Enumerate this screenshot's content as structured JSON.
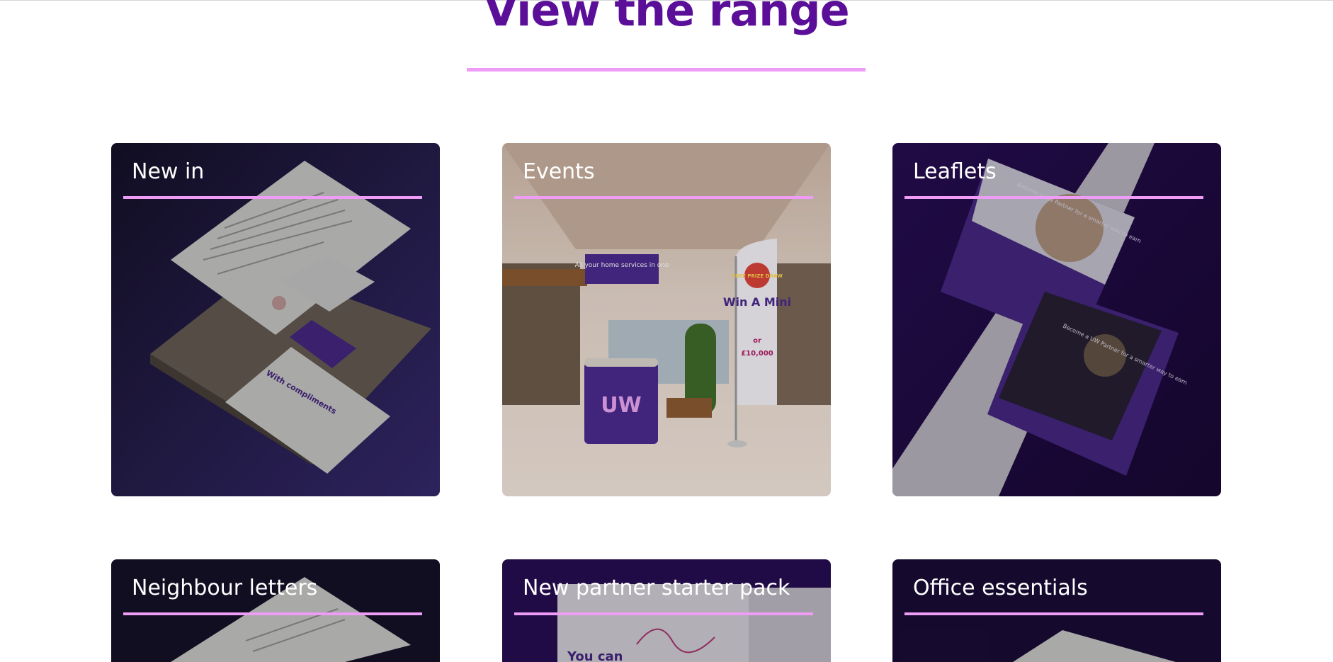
{
  "section": {
    "title": "View the range"
  },
  "cards": [
    {
      "title": "New in",
      "image": "stationery-mockup-icon"
    },
    {
      "title": "Events",
      "image": "event-stand-icon"
    },
    {
      "title": "Leaflets",
      "image": "leaflet-mockup-icon"
    },
    {
      "title": "Neighbour letters",
      "image": "letter-mockup-icon"
    },
    {
      "title": "New partner starter pack",
      "image": "starter-pack-icon"
    },
    {
      "title": "Office essentials",
      "image": "office-paper-icon"
    }
  ],
  "artwork_text": {
    "events_sign": "All your home services in one",
    "events_logo": "UW",
    "events_flag_badge": "FREE PRIZE DRAW",
    "events_flag_main": "Win A Mini",
    "events_flag_or": "or",
    "events_flag_amount": "£10,000",
    "new_in_compliments": "With compliments",
    "leaflet_1": "Become a UW Partner for a smarter way to earn",
    "leaflet_2": "Become a UW Partner for a smarter way to earn",
    "starter_pack_text": "You can"
  },
  "colors": {
    "heading": "#5b0f99",
    "accent_rule": "#ee9cf5",
    "brand_purple": "#4b2a8c",
    "card_dark": "#1a1433"
  }
}
